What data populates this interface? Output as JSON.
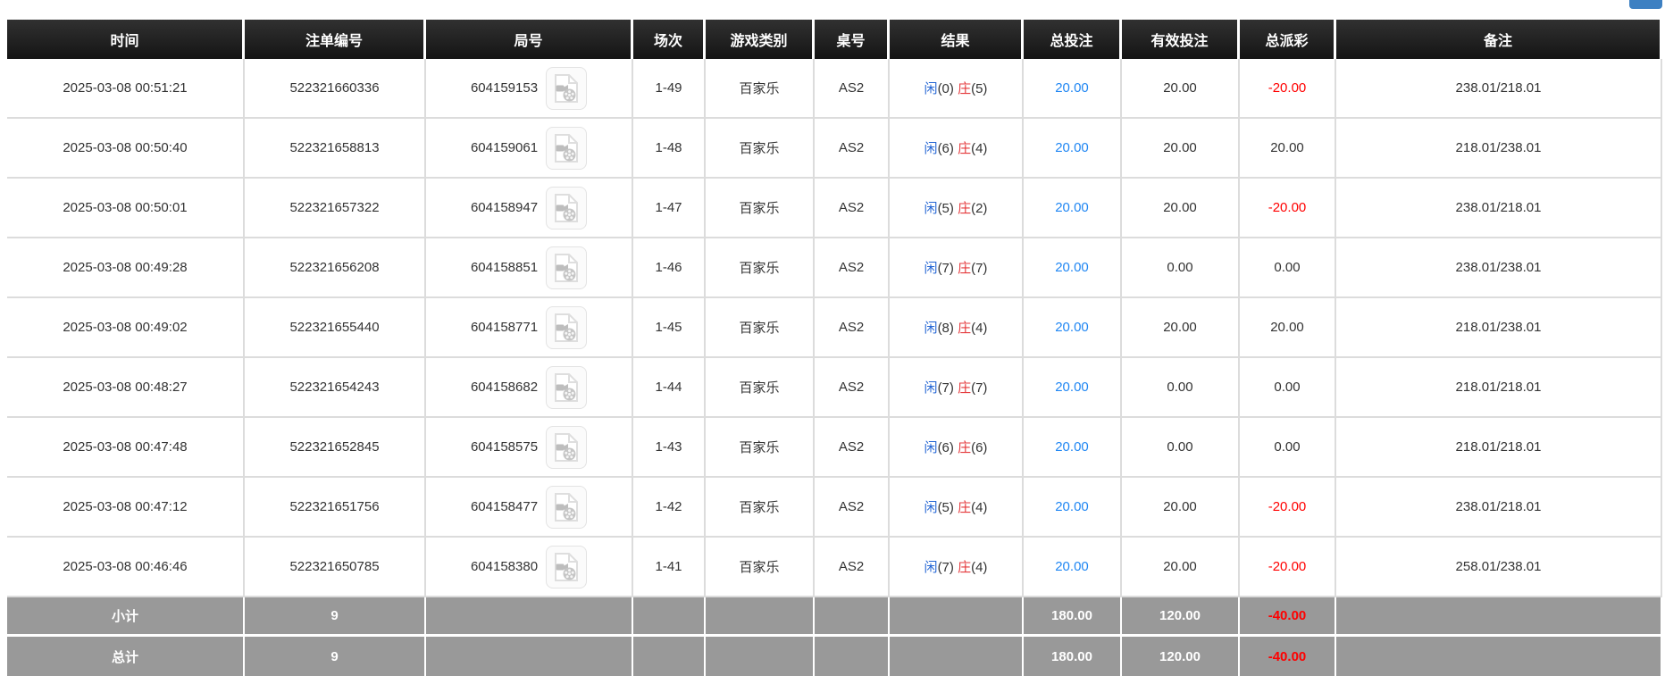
{
  "top_toolbar": {
    "partial_button_visible": true
  },
  "colors": {
    "accent_blue": "#3d80c2",
    "link_blue": "#2187f3",
    "player_blue": "#2566d4",
    "banker_red": "#e4393c",
    "neg_red": "#ff0000",
    "summary_gray": "#999999",
    "header_bg": "#1c1c1c"
  },
  "icons": {
    "video_icon": "video-file-icon"
  },
  "table": {
    "headers": [
      {
        "key": "time",
        "label": "时间"
      },
      {
        "key": "bet_no",
        "label": "注单编号"
      },
      {
        "key": "round_no",
        "label": "局号"
      },
      {
        "key": "session",
        "label": "场次"
      },
      {
        "key": "game_type",
        "label": "游戏类别"
      },
      {
        "key": "table_no",
        "label": "桌号"
      },
      {
        "key": "result",
        "label": "结果"
      },
      {
        "key": "total_bet",
        "label": "总投注"
      },
      {
        "key": "valid_bet",
        "label": "有效投注"
      },
      {
        "key": "payout",
        "label": "总派彩"
      },
      {
        "key": "remark",
        "label": "备注"
      }
    ],
    "rows": [
      {
        "time": "2025-03-08 00:51:21",
        "bet_no": "522321660336",
        "round_no": "604159153",
        "session": "1-49",
        "game_type": "百家乐",
        "table_no": "AS2",
        "result": {
          "player_label": "闲",
          "player_points": "(0)",
          "banker_label": "庄",
          "banker_points": "(5)"
        },
        "total_bet": "20.00",
        "valid_bet": "20.00",
        "payout": "-20.00",
        "remark": "238.01/218.01"
      },
      {
        "time": "2025-03-08 00:50:40",
        "bet_no": "522321658813",
        "round_no": "604159061",
        "session": "1-48",
        "game_type": "百家乐",
        "table_no": "AS2",
        "result": {
          "player_label": "闲",
          "player_points": "(6)",
          "banker_label": "庄",
          "banker_points": "(4)"
        },
        "total_bet": "20.00",
        "valid_bet": "20.00",
        "payout": "20.00",
        "remark": "218.01/238.01"
      },
      {
        "time": "2025-03-08 00:50:01",
        "bet_no": "522321657322",
        "round_no": "604158947",
        "session": "1-47",
        "game_type": "百家乐",
        "table_no": "AS2",
        "result": {
          "player_label": "闲",
          "player_points": "(5)",
          "banker_label": "庄",
          "banker_points": "(2)"
        },
        "total_bet": "20.00",
        "valid_bet": "20.00",
        "payout": "-20.00",
        "remark": "238.01/218.01"
      },
      {
        "time": "2025-03-08 00:49:28",
        "bet_no": "522321656208",
        "round_no": "604158851",
        "session": "1-46",
        "game_type": "百家乐",
        "table_no": "AS2",
        "result": {
          "player_label": "闲",
          "player_points": "(7)",
          "banker_label": "庄",
          "banker_points": "(7)"
        },
        "total_bet": "20.00",
        "valid_bet": "0.00",
        "payout": "0.00",
        "remark": "238.01/238.01"
      },
      {
        "time": "2025-03-08 00:49:02",
        "bet_no": "522321655440",
        "round_no": "604158771",
        "session": "1-45",
        "game_type": "百家乐",
        "table_no": "AS2",
        "result": {
          "player_label": "闲",
          "player_points": "(8)",
          "banker_label": "庄",
          "banker_points": "(4)"
        },
        "total_bet": "20.00",
        "valid_bet": "20.00",
        "payout": "20.00",
        "remark": "218.01/238.01"
      },
      {
        "time": "2025-03-08 00:48:27",
        "bet_no": "522321654243",
        "round_no": "604158682",
        "session": "1-44",
        "game_type": "百家乐",
        "table_no": "AS2",
        "result": {
          "player_label": "闲",
          "player_points": "(7)",
          "banker_label": "庄",
          "banker_points": "(7)"
        },
        "total_bet": "20.00",
        "valid_bet": "0.00",
        "payout": "0.00",
        "remark": "218.01/218.01"
      },
      {
        "time": "2025-03-08 00:47:48",
        "bet_no": "522321652845",
        "round_no": "604158575",
        "session": "1-43",
        "game_type": "百家乐",
        "table_no": "AS2",
        "result": {
          "player_label": "闲",
          "player_points": "(6)",
          "banker_label": "庄",
          "banker_points": "(6)"
        },
        "total_bet": "20.00",
        "valid_bet": "0.00",
        "payout": "0.00",
        "remark": "218.01/218.01"
      },
      {
        "time": "2025-03-08 00:47:12",
        "bet_no": "522321651756",
        "round_no": "604158477",
        "session": "1-42",
        "game_type": "百家乐",
        "table_no": "AS2",
        "result": {
          "player_label": "闲",
          "player_points": "(5)",
          "banker_label": "庄",
          "banker_points": "(4)"
        },
        "total_bet": "20.00",
        "valid_bet": "20.00",
        "payout": "-20.00",
        "remark": "238.01/218.01"
      },
      {
        "time": "2025-03-08 00:46:46",
        "bet_no": "522321650785",
        "round_no": "604158380",
        "session": "1-41",
        "game_type": "百家乐",
        "table_no": "AS2",
        "result": {
          "player_label": "闲",
          "player_points": "(7)",
          "banker_label": "庄",
          "banker_points": "(4)"
        },
        "total_bet": "20.00",
        "valid_bet": "20.00",
        "payout": "-20.00",
        "remark": "258.01/238.01"
      }
    ],
    "summary_rows": [
      {
        "kind": "subtotal",
        "label": "小计",
        "count": "9",
        "total_bet": "180.00",
        "valid_bet": "120.00",
        "payout": "-40.00"
      },
      {
        "kind": "total",
        "label": "总计",
        "count": "9",
        "total_bet": "180.00",
        "valid_bet": "120.00",
        "payout": "-40.00"
      }
    ]
  }
}
